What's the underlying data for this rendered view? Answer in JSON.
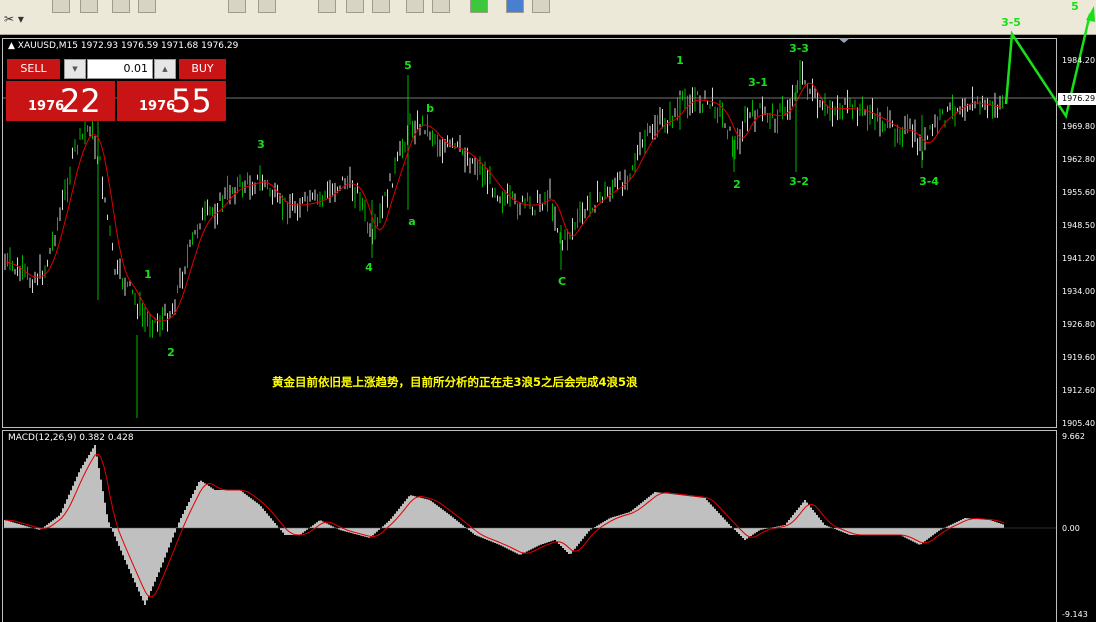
{
  "chart_header": {
    "symbol": "XAUUSD,M15",
    "ohlc": "1972.93 1976.59 1971.68 1976.29"
  },
  "trade_panel": {
    "sell_label": "SELL",
    "buy_label": "BUY",
    "lot_size": "0.01",
    "sell_price_small": "1976",
    "sell_price_big": "22",
    "buy_price_small": "1976",
    "buy_price_big": "55"
  },
  "price_axis": [
    "1984.20",
    "1969.80",
    "1962.80",
    "1955.60",
    "1948.50",
    "1941.20",
    "1934.00",
    "1926.80",
    "1919.60",
    "1912.60",
    "1905.40"
  ],
  "current_price": "1976.29",
  "macd": {
    "label": "MACD(12,26,9) 0.382 0.428",
    "axis": [
      "9.662",
      "0.00",
      "-9.143"
    ]
  },
  "wave_labels": [
    "1",
    "2",
    "3",
    "4",
    "5",
    "a",
    "b",
    "C",
    "1",
    "2",
    "3-1",
    "3-2",
    "3-3",
    "3-4",
    "3-5",
    "5"
  ],
  "annotation": "黄金目前依旧是上涨趋势，目前所分析的正在走3浪5之后会完成4浪5浪",
  "colors": {
    "candle": "#00b400",
    "ma": "#e00000",
    "wave": "#18e018",
    "annotation": "#ffff00",
    "panel_red": "#c81414"
  }
}
